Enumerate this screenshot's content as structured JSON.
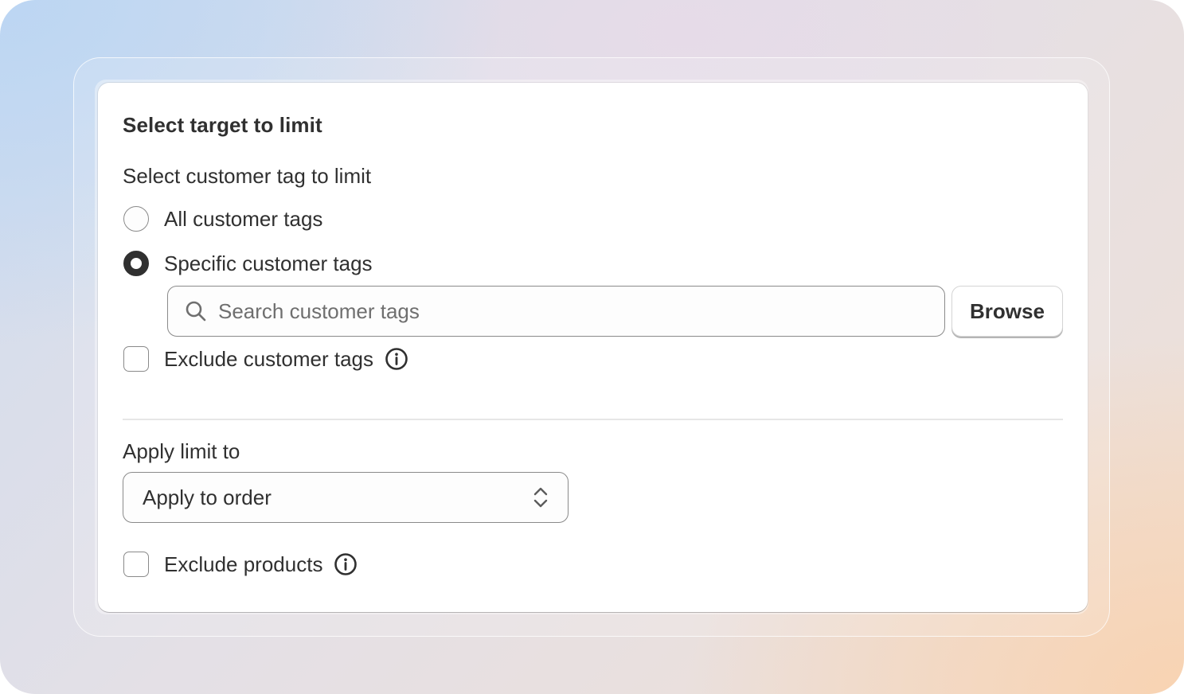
{
  "card": {
    "title": "Select target to limit"
  },
  "customer_tags": {
    "section_label": "Select customer tag to limit",
    "options": [
      {
        "label": "All customer tags",
        "checked": false
      },
      {
        "label": "Specific customer tags",
        "checked": true
      }
    ],
    "search": {
      "placeholder": "Search customer tags",
      "value": "",
      "icon": "search-icon"
    },
    "browse_label": "Browse",
    "exclude": {
      "label": "Exclude customer tags",
      "checked": false,
      "icon": "info-icon"
    }
  },
  "apply_limit": {
    "section_label": "Apply limit to",
    "selected": "Apply to order",
    "chevron_icon": "select-chevron-icon"
  },
  "exclude_products": {
    "label": "Exclude products",
    "checked": false,
    "icon": "info-icon"
  },
  "colors": {
    "text": "#303030",
    "border": "#8a8a8a",
    "card_background": "#ffffff",
    "divider": "#e6e6e6",
    "background_gradient_start": "#bcd6f3",
    "background_gradient_end": "#f8d3b2"
  }
}
